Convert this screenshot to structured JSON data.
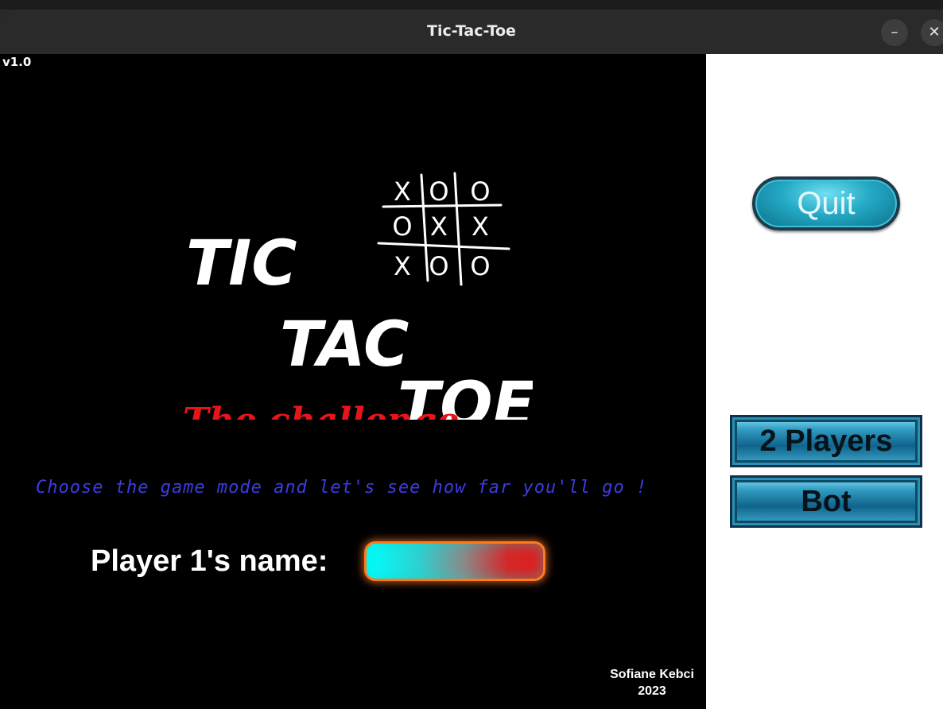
{
  "window": {
    "title": "Tic-Tac-Toe",
    "minimize_glyph": "–",
    "close_glyph": "✕"
  },
  "version": "v1.0",
  "logo": {
    "line1": "TIC",
    "line2": "TAC",
    "line3": "TOE",
    "subtitle": "The challenge",
    "grid_marks": [
      "X",
      "O",
      "O",
      "O",
      "X",
      "X",
      "X",
      "O",
      "O"
    ]
  },
  "tagline": "Choose the game mode and let's see how far you'll go !",
  "name_field": {
    "label": "Player 1's name:",
    "value": "",
    "placeholder": ""
  },
  "credit": {
    "author": "Sofiane Kebci",
    "year": "2023"
  },
  "buttons": {
    "quit": "Quit",
    "two_players": "2 Players",
    "bot": "Bot"
  },
  "icons": {
    "minimize": "minimize-icon",
    "close": "close-icon"
  },
  "colors": {
    "accent_blue": "#3c3ce0",
    "challenge_red": "#e8141b",
    "button_teal": "#23a9c4"
  }
}
